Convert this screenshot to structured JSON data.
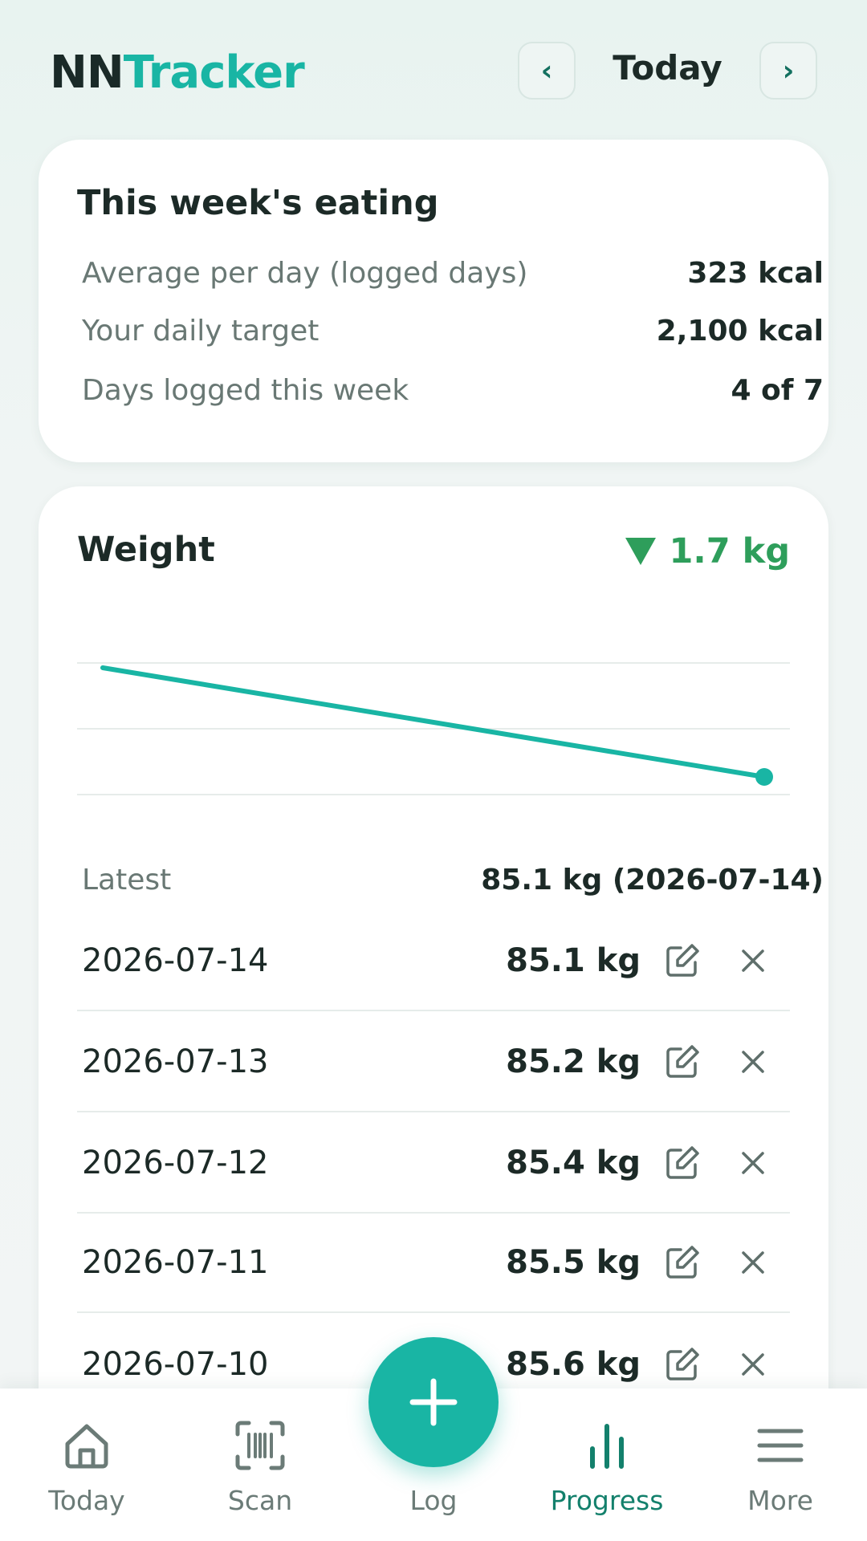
{
  "app": {
    "logo_part1": "NN",
    "logo_part2": "Tracker",
    "accent_color": "#19b5a4"
  },
  "header": {
    "date_label": "Today",
    "prev_icon": "chevron-left-icon",
    "next_icon": "chevron-right-icon"
  },
  "eating": {
    "title": "This week's eating",
    "rows": [
      {
        "label": "Average per day (logged days)",
        "value": "323 kcal"
      },
      {
        "label": "Your daily target",
        "value": "2,100 kcal"
      },
      {
        "label": "Days logged this week",
        "value": "4 of 7"
      }
    ]
  },
  "weight": {
    "title": "Weight",
    "delta": "1.7 kg",
    "delta_direction": "down",
    "delta_color": "#2e9e5b",
    "latest_label": "Latest",
    "latest_value": "85.1 kg (2026-07-14)",
    "entries": [
      {
        "date": "2026-07-14",
        "weight": "85.1 kg"
      },
      {
        "date": "2026-07-13",
        "weight": "85.2 kg"
      },
      {
        "date": "2026-07-12",
        "weight": "85.4 kg"
      },
      {
        "date": "2026-07-11",
        "weight": "85.5 kg"
      },
      {
        "date": "2026-07-10",
        "weight": "85.6 kg"
      }
    ]
  },
  "chart_data": {
    "type": "line",
    "title": "",
    "grid": true,
    "color": "#19b5a4",
    "series": [
      {
        "values": [
          86.8,
          85.1
        ]
      }
    ],
    "ylim": [
      84.5,
      87.0
    ],
    "last_point_marker": true
  },
  "bottom_nav": {
    "items": [
      {
        "label": "Today",
        "icon": "home-icon"
      },
      {
        "label": "Scan",
        "icon": "barcode-scan-icon"
      },
      {
        "label": "Log",
        "icon": "plus-icon"
      },
      {
        "label": "Progress",
        "icon": "bar-chart-icon",
        "active": true
      },
      {
        "label": "More",
        "icon": "menu-icon"
      }
    ]
  }
}
